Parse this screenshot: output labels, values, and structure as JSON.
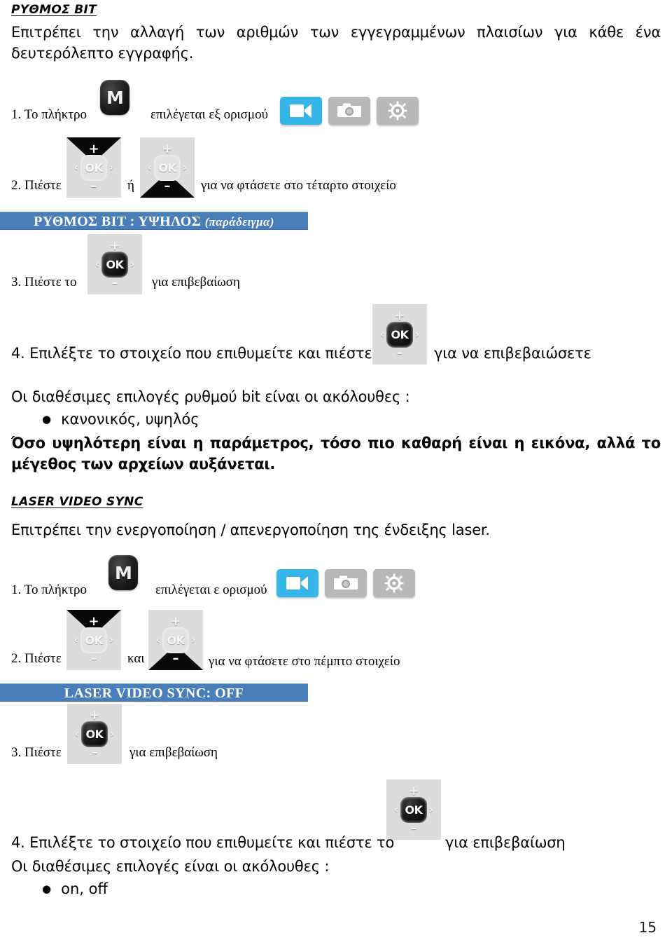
{
  "page": {
    "number": "15"
  },
  "sections": [
    {
      "title": "ΡΥΘΜΟΣ ΒΙΤ",
      "description": "Επιτρέπει την αλλαγή των αριθμών των εγγεγραμμένων πλαισίων για κάθε ένα δευτερόλεπτο εγγραφής.",
      "steps": {
        "step1_prefix": "1. Το πλήκτρο",
        "step1_suffix": "επιλέγεται εξ ορισμού",
        "step2_prefix": "2. Πιέστε",
        "step2_middle": "ή",
        "step2_suffix": "για να φτάσετε στο τέταρτο στοιχείο",
        "step3_prefix": "3. Πιέστε το",
        "step3_suffix": "για επιβεβαίωση",
        "step4_prefix": "4. Επιλέξτε το στοιχείο που επιθυμείτε και πιέστε",
        "step4_suffix": "για να επιβεβαιώσετε"
      },
      "banner": {
        "main": "ΡΥΘΜΟΣ ΒΙΤ : ΥΨΗΛΟΣ",
        "paren": "(παράδειγμα)"
      },
      "options_intro": "Οι διαθέσιμες επιλογές ρυθμού bit είναι οι ακόλουθες :",
      "options": [
        "κανονικός, υψηλός"
      ],
      "note": "Όσο υψηλότερη είναι η παράμετρος, τόσο πιο καθαρή είναι η εικόνα, αλλά το μέγεθος των αρχείων αυξάνεται."
    },
    {
      "title": "LASER VIDEO SYNC",
      "description": "Επιτρέπει την ενεργοποίηση / απενεργοποίηση της ένδειξης laser.",
      "steps": {
        "step1_prefix": "1. Το πλήκτρο",
        "step1_suffix": "επιλέγεται ε ορισμού",
        "step2_prefix": "2. Πιέστε",
        "step2_middle": "και",
        "step2_suffix": "για να φτάσετε στο πέμπτο στοιχείο",
        "step3_prefix": "3. Πιέστε",
        "step3_suffix": "για επιβεβαίωση",
        "step4_prefix": "4. Επιλέξτε το στοιχείο που επιθυμείτε και πιέστε το",
        "step4_suffix": "για επιβεβαίωση"
      },
      "banner": {
        "main": "LASER VIDEO SYNC: OFF",
        "paren": ""
      },
      "options_intro": "Οι διαθέσιμες επιλογές είναι οι ακόλουθες :",
      "options": [
        "on, off"
      ],
      "note": ""
    }
  ],
  "controls": {
    "m_key_label": "M",
    "navpad": {
      "up_label": "+",
      "down_label": "–",
      "left_label": "‹",
      "right_label": "›",
      "ok_label": "OK"
    },
    "mode_icons": [
      {
        "name": "video-camera-icon",
        "state": "active"
      },
      {
        "name": "photo-camera-icon",
        "state": "inactive"
      },
      {
        "name": "settings-gear-icon",
        "state": "inactive"
      }
    ]
  },
  "colors": {
    "banner_blue": "#4a7ebb",
    "active_tile_blue": "#35b4e8",
    "inactive_tile_gray": "#b8b8b8"
  }
}
